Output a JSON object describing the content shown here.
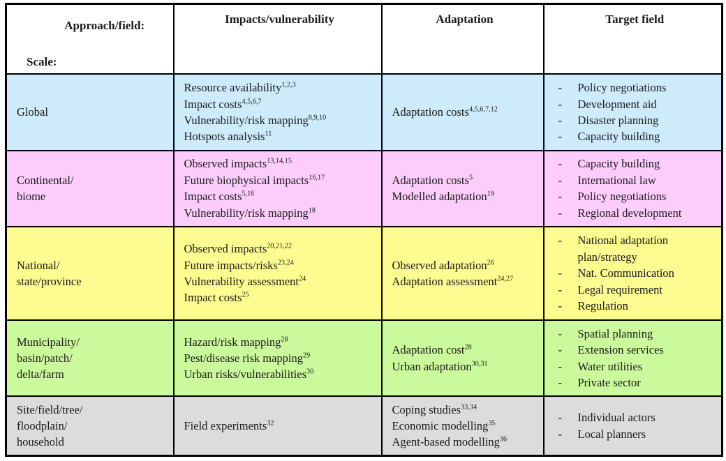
{
  "table": {
    "columns": [
      {
        "key": "scale",
        "label_top": "Approach/field:",
        "label_bottom": "Scale:"
      },
      {
        "key": "impact",
        "label": "Impacts/vulnerability"
      },
      {
        "key": "adapt",
        "label": "Adaptation"
      },
      {
        "key": "target",
        "label": "Target field"
      }
    ],
    "row_colors": {
      "global": "#cdebfa",
      "continental": "#fccdfb",
      "national": "#fcfc91",
      "municipality": "#cafa9b",
      "site": "#dcdcdc"
    },
    "rows": [
      {
        "id": "global",
        "color": "#cdebfa",
        "scale": [
          "Global"
        ],
        "impact": [
          {
            "text": "Resource availability",
            "refs": "1,2,3"
          },
          {
            "text": "Impact costs",
            "refs": "4,5,6,7"
          },
          {
            "text": "Vulnerability/risk mapping",
            "refs": "8,9,10"
          },
          {
            "text": "Hotspots analysis",
            "refs": "11"
          }
        ],
        "adapt": [
          {
            "text": "Adaptation costs",
            "refs": "4,5,6,7,12"
          }
        ],
        "target": [
          "Policy negotiations",
          "Development aid",
          "Disaster planning",
          "Capacity building"
        ]
      },
      {
        "id": "continental",
        "color": "#fccdfb",
        "scale": [
          "Continental/",
          "biome"
        ],
        "impact": [
          {
            "text": "Observed impacts",
            "refs": "13,14,15"
          },
          {
            "text": "Future biophysical impacts",
            "refs": "16,17"
          },
          {
            "text": "Impact costs",
            "refs": "5,16"
          },
          {
            "text": "Vulnerability/risk mapping",
            "refs": "18"
          }
        ],
        "adapt": [
          {
            "text": "Adaptation costs",
            "refs": "5"
          },
          {
            "text": "Modelled adaptation",
            "refs": "19"
          }
        ],
        "target": [
          "Capacity building",
          "International law",
          "Policy negotiations",
          "Regional development"
        ]
      },
      {
        "id": "national",
        "color": "#fcfc91",
        "scale": [
          "National/",
          "state/province"
        ],
        "impact": [
          {
            "text": "Observed impacts",
            "refs": "20,21,22"
          },
          {
            "text": "Future impacts/risks",
            "refs": "23,24"
          },
          {
            "text": "Vulnerability assessment",
            "refs": "24"
          },
          {
            "text": "Impact costs",
            "refs": "25"
          }
        ],
        "adapt": [
          {
            "text": "Observed adaptation",
            "refs": "26"
          },
          {
            "text": "Adaptation assessment",
            "refs": "24,27"
          }
        ],
        "target": [
          "National adaptation plan/strategy",
          "Nat. Communication",
          "Legal requirement",
          "Regulation"
        ]
      },
      {
        "id": "municipality",
        "color": "#cafa9b",
        "scale": [
          "Municipality/",
          "basin/patch/",
          "delta/farm"
        ],
        "impact": [
          {
            "text": "Hazard/risk mapping",
            "refs": "28"
          },
          {
            "text": "Pest/disease risk mapping",
            "refs": "29"
          },
          {
            "text": "Urban risks/vulnerabilities",
            "refs": "30"
          }
        ],
        "adapt": [
          {
            "text": "Adaptation cost",
            "refs": "28"
          },
          {
            "text": "Urban adaptation",
            "refs": "30,31"
          }
        ],
        "target": [
          "Spatial planning",
          "Extension services",
          "Water utilities",
          "Private sector"
        ]
      },
      {
        "id": "site",
        "color": "#dcdcdc",
        "scale": [
          "Site/field/tree/",
          "floodplain/",
          "household"
        ],
        "impact": [
          {
            "text": "Field experiments",
            "refs": "32"
          }
        ],
        "adapt": [
          {
            "text": "Coping studies",
            "refs": "33,34"
          },
          {
            "text": "Economic modelling",
            "refs": "35"
          },
          {
            "text": "Agent-based modelling",
            "refs": "36"
          }
        ],
        "target": [
          "Individual actors",
          "Local planners"
        ]
      }
    ],
    "bullet_marker": "-"
  }
}
